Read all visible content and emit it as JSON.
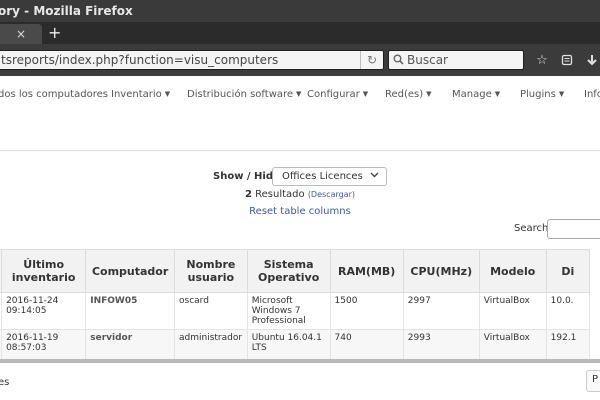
{
  "window": {
    "title": "ory - Mozilla Firefox"
  },
  "tabs": {
    "close_glyph": "×",
    "new_tab_glyph": "+"
  },
  "navbar": {
    "url": "tsreports/index.php?function=visu_computers",
    "reload_glyph": "↻",
    "search_placeholder": "Buscar",
    "search_icon": "search-icon",
    "icons": [
      "bookmark-star-icon",
      "reading-list-icon",
      "download-icon"
    ]
  },
  "menu": {
    "items": [
      {
        "label": "dos los computadores",
        "caret": false
      },
      {
        "label": "Inventario",
        "caret": true
      },
      {
        "label": "Distribución software",
        "caret": true
      },
      {
        "label": "Configurar",
        "caret": true
      },
      {
        "label": "Red(es)",
        "caret": true
      },
      {
        "label": "Manage",
        "caret": true
      },
      {
        "label": "Plugins",
        "caret": true
      },
      {
        "label": "Info",
        "caret": false
      }
    ]
  },
  "controls": {
    "show_hide_label": "Show / Hide :",
    "show_hide_value": "Offices Licences",
    "result_count": "2",
    "result_word": "Resultado",
    "download_label": "(Descargar)",
    "reset_label": "Reset table columns",
    "search_label": "Search:"
  },
  "table": {
    "headers": [
      "",
      "Último inventario",
      "Computador",
      "Nombre usuario",
      "Sistema Operativo",
      "RAM(MB)",
      "CPU(MHz)",
      "Modelo",
      "Di"
    ],
    "rows": [
      [
        "",
        "2016-11-24 09:14:05",
        "INFOW05",
        "oscard",
        "Microsoft Windows 7 Professional",
        "1500",
        "2997",
        "VirtualBox",
        "10.0."
      ],
      [
        "",
        "2016-11-19 08:57:03",
        "servidor",
        "administrador",
        "Ubuntu 16.04.1 LTS",
        "740",
        "2993",
        "VirtualBox",
        "192.1"
      ]
    ]
  },
  "footer": {
    "text": "es",
    "button_label": "P"
  },
  "colors": {
    "title_bar": "#3a3a3a",
    "link": "#3a5aa8",
    "header_bg": "#f2f2f2"
  }
}
